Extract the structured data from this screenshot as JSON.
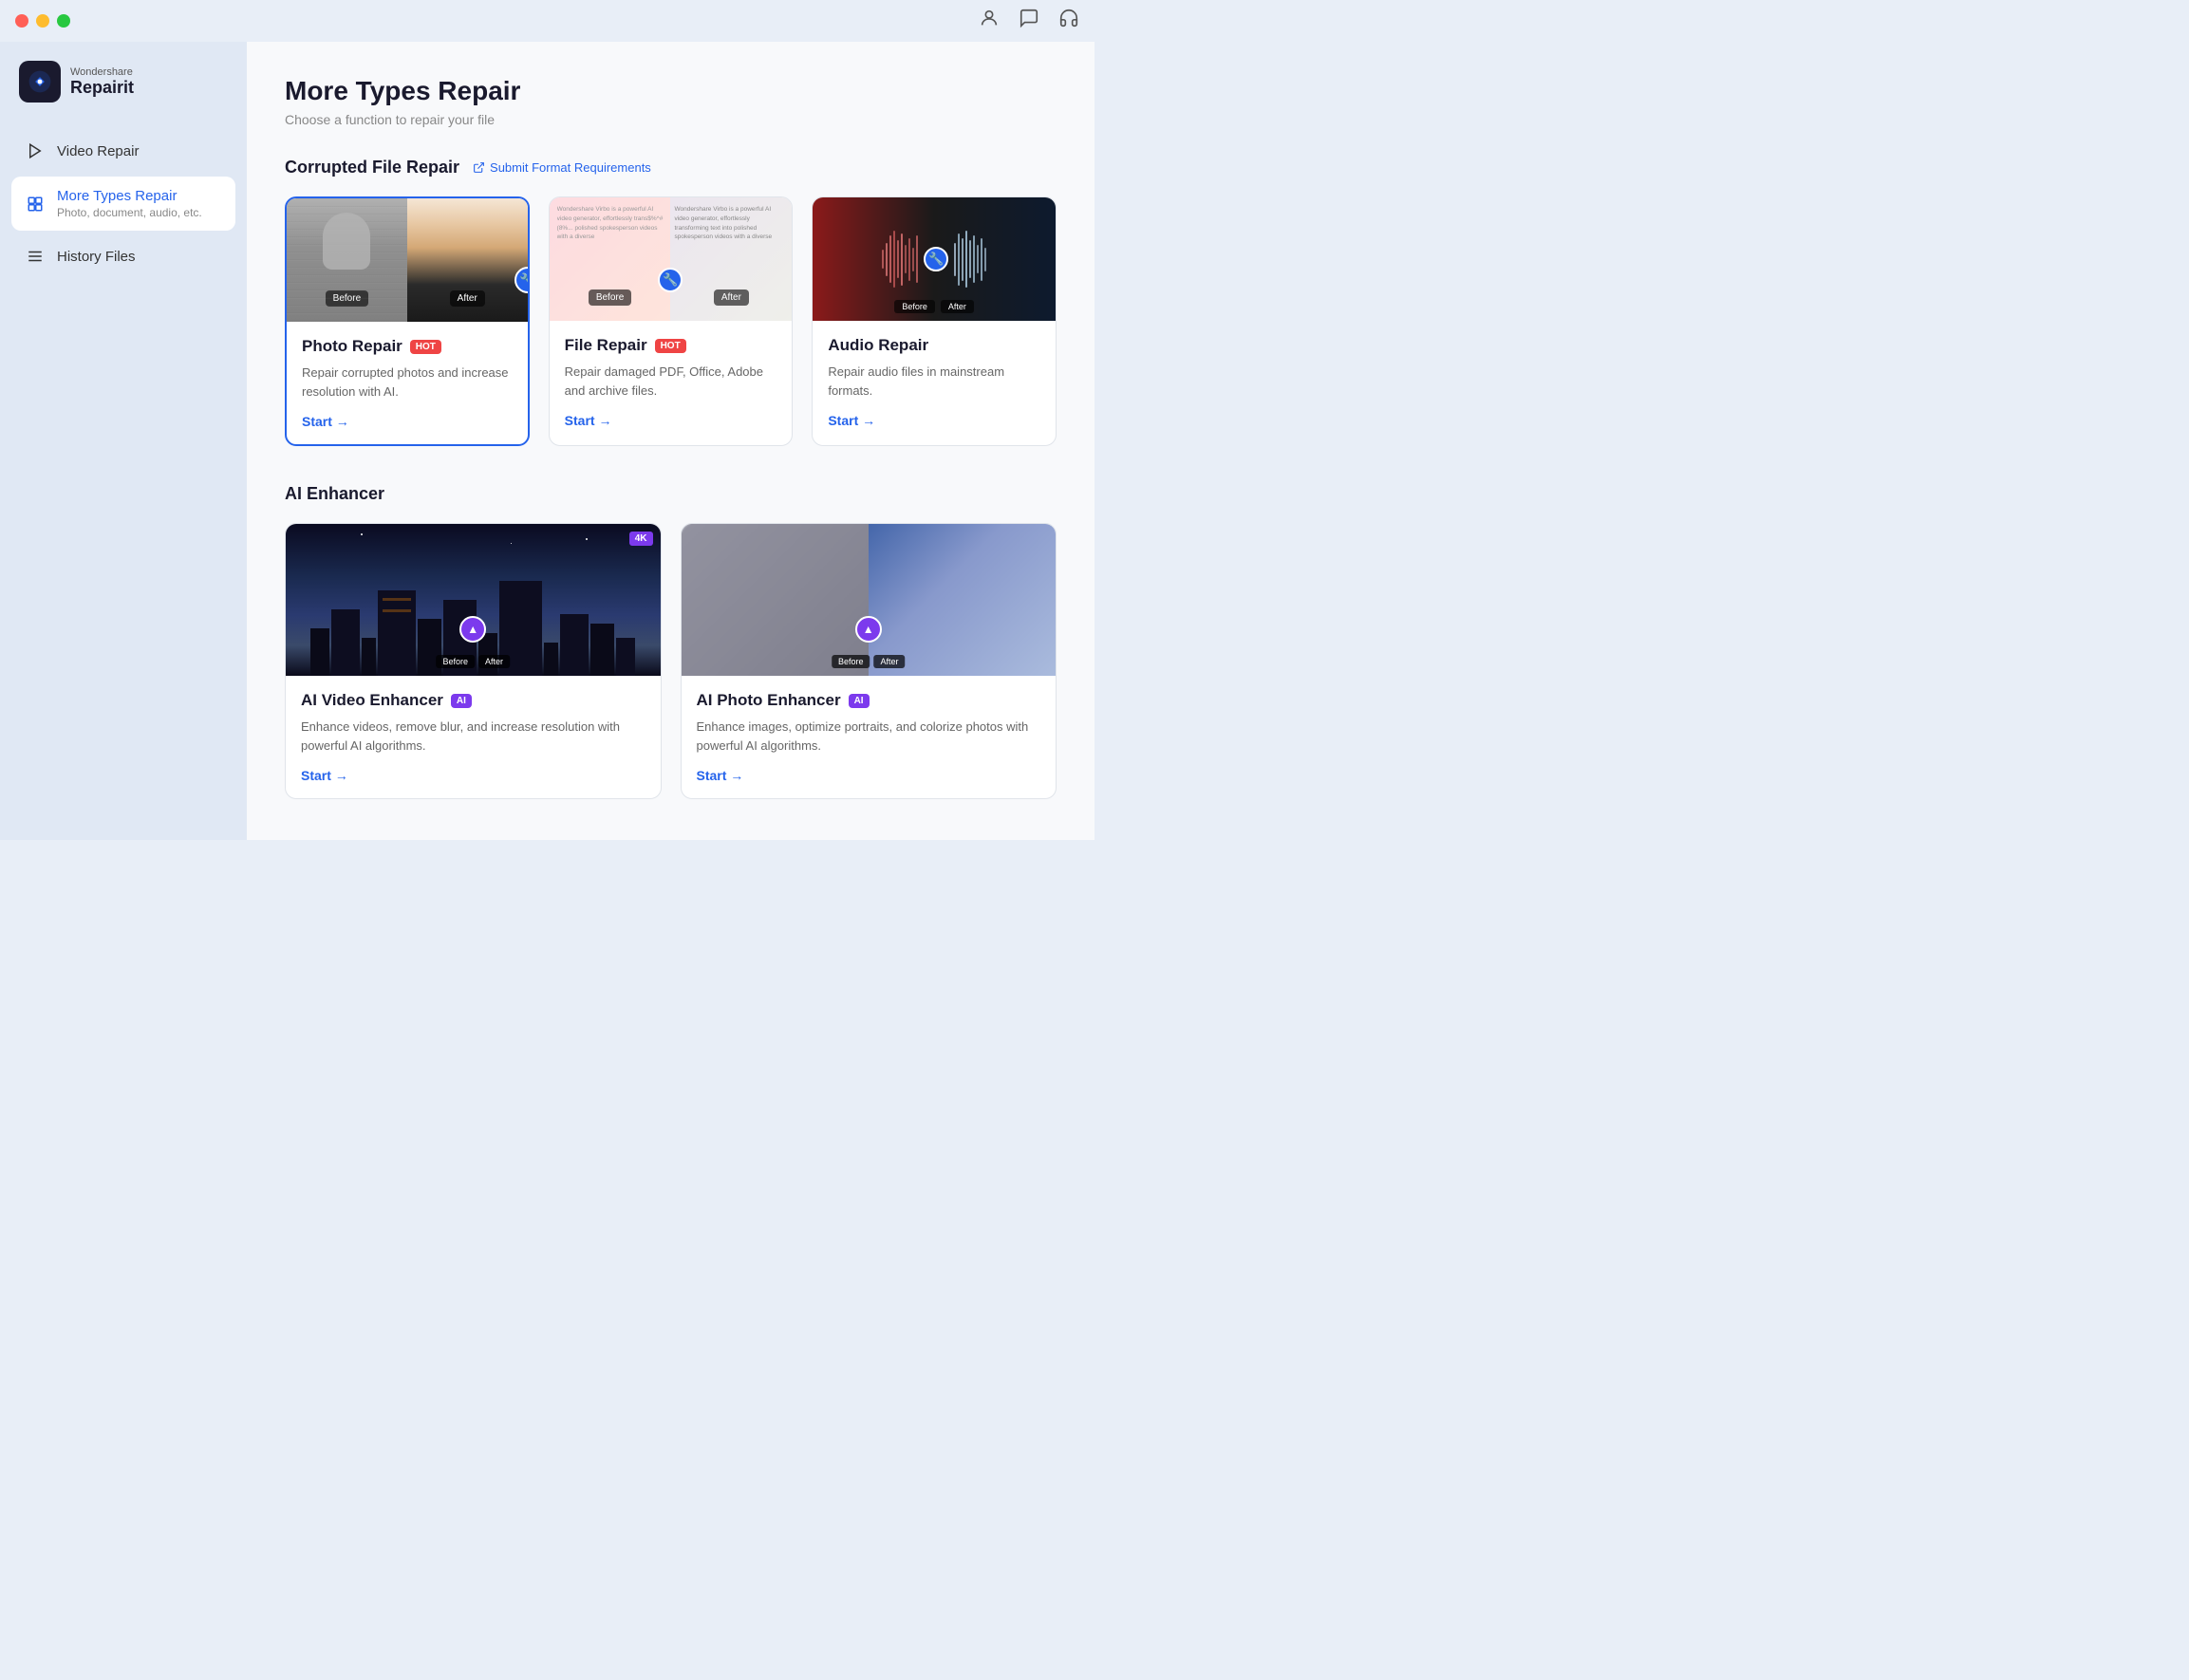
{
  "app": {
    "brand": "Wondershare",
    "product": "Repairit"
  },
  "titlebar": {
    "icons": [
      "person-icon",
      "chat-icon",
      "headphones-icon"
    ]
  },
  "sidebar": {
    "items": [
      {
        "id": "video-repair",
        "label": "Video Repair",
        "icon": "▶",
        "active": false
      },
      {
        "id": "more-types-repair",
        "label": "More Types Repair",
        "subtitle": "Photo, document, audio, etc.",
        "icon": "◈",
        "active": true
      },
      {
        "id": "history-files",
        "label": "History Files",
        "icon": "☰",
        "active": false
      }
    ]
  },
  "main": {
    "title": "More Types Repair",
    "subtitle": "Choose a function to repair your file",
    "sections": [
      {
        "id": "corrupted-file-repair",
        "title": "Corrupted File Repair",
        "link_label": "Submit Format Requirements",
        "cards": [
          {
            "id": "photo-repair",
            "title": "Photo Repair",
            "badge": "HOT",
            "badge_type": "hot",
            "description": "Repair corrupted photos and increase resolution with AI.",
            "start_label": "Start →",
            "selected": true
          },
          {
            "id": "file-repair",
            "title": "File Repair",
            "badge": "HOT",
            "badge_type": "hot",
            "description": "Repair damaged PDF, Office, Adobe and archive files.",
            "start_label": "Start →",
            "selected": false
          },
          {
            "id": "audio-repair",
            "title": "Audio Repair",
            "badge": null,
            "description": "Repair audio files in mainstream formats.",
            "start_label": "Start →",
            "selected": false
          }
        ]
      },
      {
        "id": "ai-enhancer",
        "title": "AI Enhancer",
        "cards": [
          {
            "id": "ai-video-enhancer",
            "title": "AI Video Enhancer",
            "badge": "AI",
            "badge_type": "ai",
            "description": "Enhance videos, remove blur, and increase resolution with powerful AI algorithms.",
            "start_label": "Start →"
          },
          {
            "id": "ai-photo-enhancer",
            "title": "AI Photo Enhancer",
            "badge": "AI",
            "badge_type": "ai",
            "description": "Enhance images, optimize portraits, and colorize photos with powerful AI algorithms.",
            "start_label": "Start →"
          }
        ]
      }
    ]
  }
}
